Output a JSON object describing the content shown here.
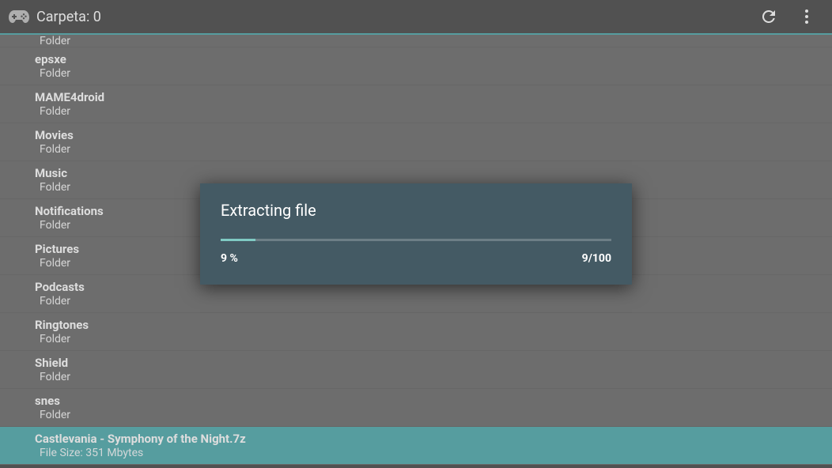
{
  "header": {
    "title": "Carpeta: 0"
  },
  "list": {
    "items": [
      {
        "name": "",
        "sub": "Folder",
        "partial": true
      },
      {
        "name": "epsxe",
        "sub": "Folder"
      },
      {
        "name": "MAME4droid",
        "sub": "Folder"
      },
      {
        "name": "Movies",
        "sub": "Folder"
      },
      {
        "name": "Music",
        "sub": "Folder"
      },
      {
        "name": "Notifications",
        "sub": "Folder"
      },
      {
        "name": "Pictures",
        "sub": "Folder"
      },
      {
        "name": "Podcasts",
        "sub": "Folder"
      },
      {
        "name": "Ringtones",
        "sub": "Folder"
      },
      {
        "name": "Shield",
        "sub": "Folder"
      },
      {
        "name": "snes",
        "sub": "Folder"
      },
      {
        "name": "Castlevania - Symphony of the Night.7z",
        "sub": "File Size: 351 Mbytes",
        "selected": true
      }
    ]
  },
  "dialog": {
    "title": "Extracting file",
    "progress_percent": 9,
    "progress_label": "9 %",
    "progress_fraction": "9/100"
  },
  "colors": {
    "accent": "#0a8a8f",
    "dialog_bg": "#445a64",
    "progress_fill": "#7fcac3"
  }
}
